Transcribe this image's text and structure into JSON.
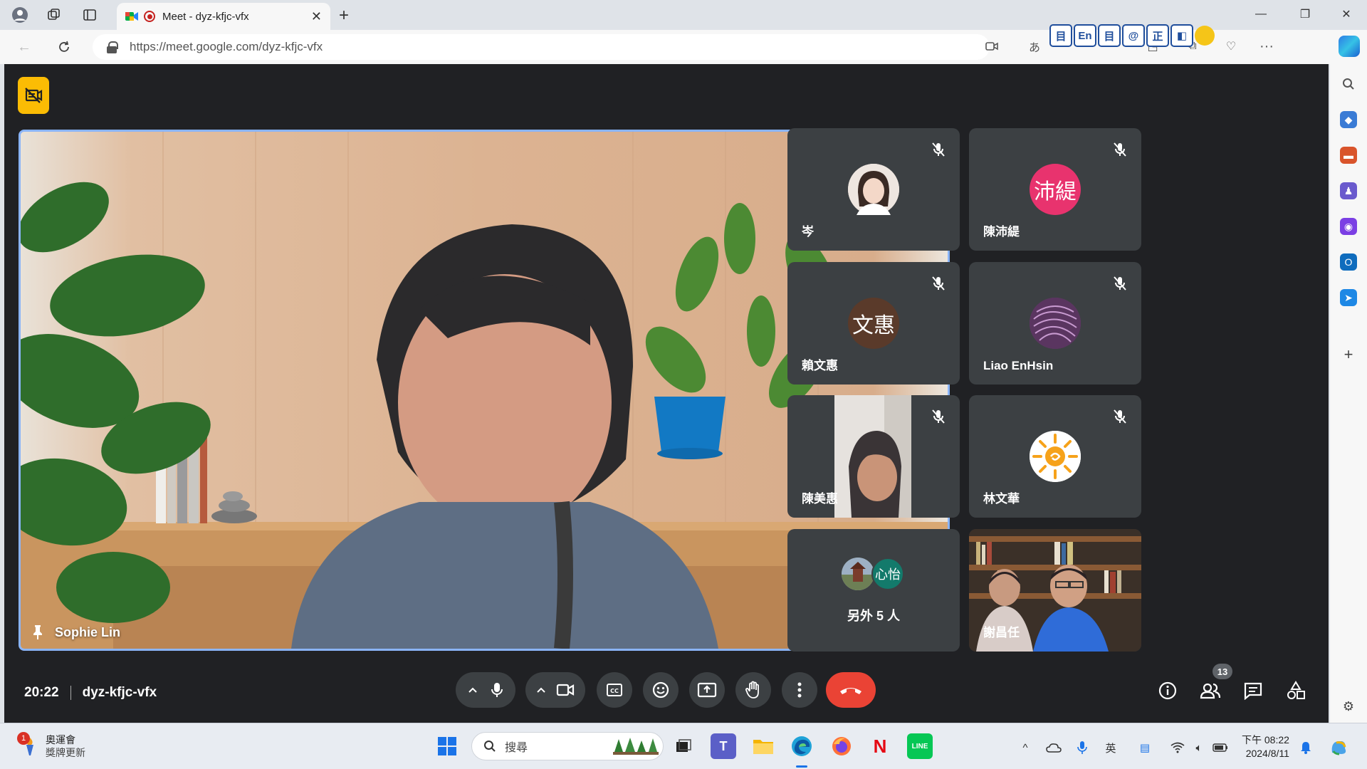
{
  "browser": {
    "tab_title": "Meet - dyz-kfjc-vfx",
    "url": "https://meet.google.com/dyz-kfjc-vfx",
    "extensions": [
      "目",
      "En",
      "目",
      "@",
      "正",
      "◧"
    ]
  },
  "meet": {
    "main_speaker": "Sophie Lin",
    "tiles": [
      {
        "name": "岑",
        "avatar": "photo"
      },
      {
        "name": "陳沛緹",
        "avatar_text": "沛緹",
        "avatar_color": "#e8336e"
      },
      {
        "name": "賴文惠",
        "avatar_text": "文惠",
        "avatar_color": "#5a3a2a"
      },
      {
        "name": "Liao EnHsin",
        "avatar": "pattern"
      },
      {
        "name": "陳美惠",
        "avatar": "video"
      },
      {
        "name": "林文華",
        "avatar": "sun"
      },
      {
        "more_label": "另外 5 人",
        "mini_avatar_text": "心怡",
        "mini_avatar_color": "#137a6b"
      },
      {
        "name": "謝昌任",
        "avatar": "video"
      }
    ],
    "time": "20:22",
    "meeting_code": "dyz-kfjc-vfx",
    "participant_count": "13",
    "colors": {
      "end_call": "#ea4335",
      "accent": "#8ab4f8",
      "background": "#202124",
      "tile": "#3c4043"
    }
  },
  "taskbar": {
    "weather_title": "奧運會",
    "weather_sub": "獎牌更新",
    "weather_badge": "1",
    "search_placeholder": "搜尋",
    "time": "下午 08:22",
    "date": "2024/8/11"
  }
}
